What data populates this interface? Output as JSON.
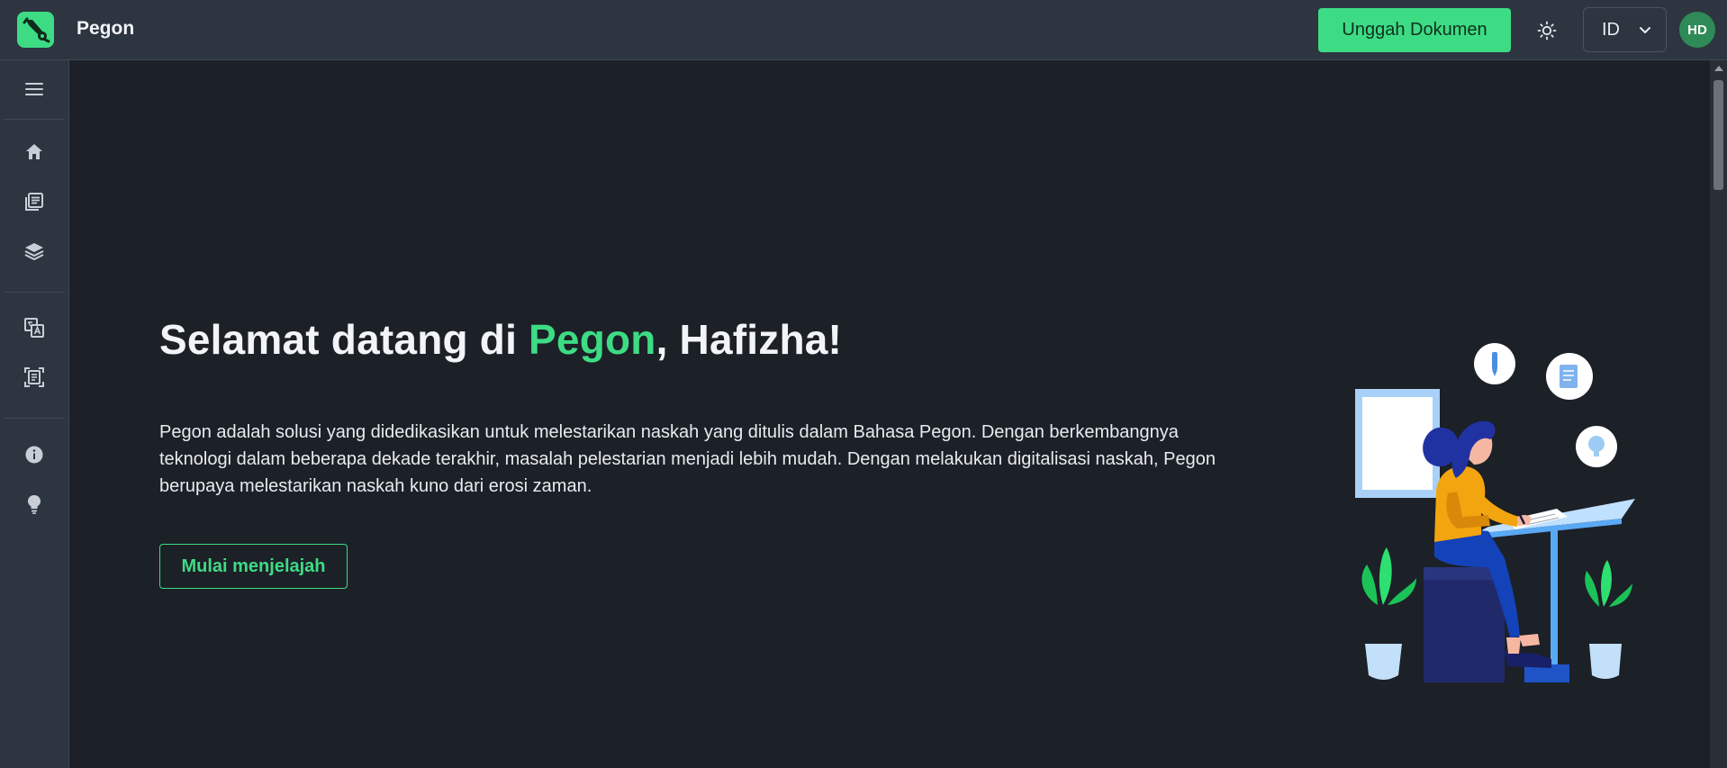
{
  "header": {
    "app_name": "Pegon",
    "upload_label": "Unggah Dokumen",
    "language": "ID",
    "avatar_initials": "HD"
  },
  "sidebar": {
    "items": [
      {
        "icon": "menu-icon"
      },
      {
        "icon": "home-icon"
      },
      {
        "icon": "documents-icon"
      },
      {
        "icon": "layers-icon"
      },
      {
        "icon": "translate-icon"
      },
      {
        "icon": "scan-document-icon"
      },
      {
        "icon": "info-icon"
      },
      {
        "icon": "lightbulb-icon"
      }
    ]
  },
  "hero": {
    "title_prefix": "Selamat datang di ",
    "title_accent": "Pegon",
    "title_suffix": ", Hafizha!",
    "description": "Pegon adalah solusi yang didedikasikan untuk melestarikan naskah yang ditulis dalam Bahasa Pegon. Dengan berkembangnya teknologi dalam beberapa dekade terakhir, masalah pelestarian menjadi lebih mudah. Dengan melakukan digitalisasi naskah, Pegon berupaya melestarikan naskah kuno dari erosi zaman.",
    "cta_label": "Mulai menjelajah"
  },
  "colors": {
    "accent": "#3ddc84",
    "topbar_bg": "#2d3540",
    "main_bg": "#1c2027"
  }
}
